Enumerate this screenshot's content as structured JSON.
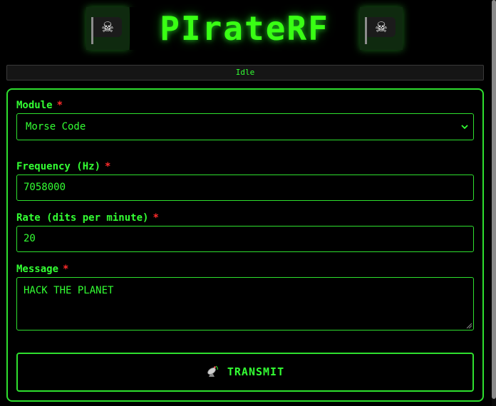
{
  "header": {
    "title": "PIrateRF",
    "left_icon": "pirate-flag",
    "right_icon": "pirate-flag"
  },
  "status": {
    "text": "Idle"
  },
  "form": {
    "module": {
      "label": "Module",
      "required_mark": "*",
      "selected": "Morse Code"
    },
    "frequency": {
      "label": "Frequency (Hz)",
      "required_mark": "*",
      "value": "7058000"
    },
    "rate": {
      "label": "Rate (dits per minute)",
      "required_mark": "*",
      "value": "20"
    },
    "message": {
      "label": "Message",
      "required_mark": "*",
      "value": "HACK THE PLANET"
    },
    "transmit": {
      "label": "TRANSMIT",
      "icon": "satellite-antenna"
    }
  },
  "colors": {
    "accent": "#33ff33",
    "border": "#2ee02e",
    "required": "#ff2b2b",
    "background": "#000000"
  }
}
